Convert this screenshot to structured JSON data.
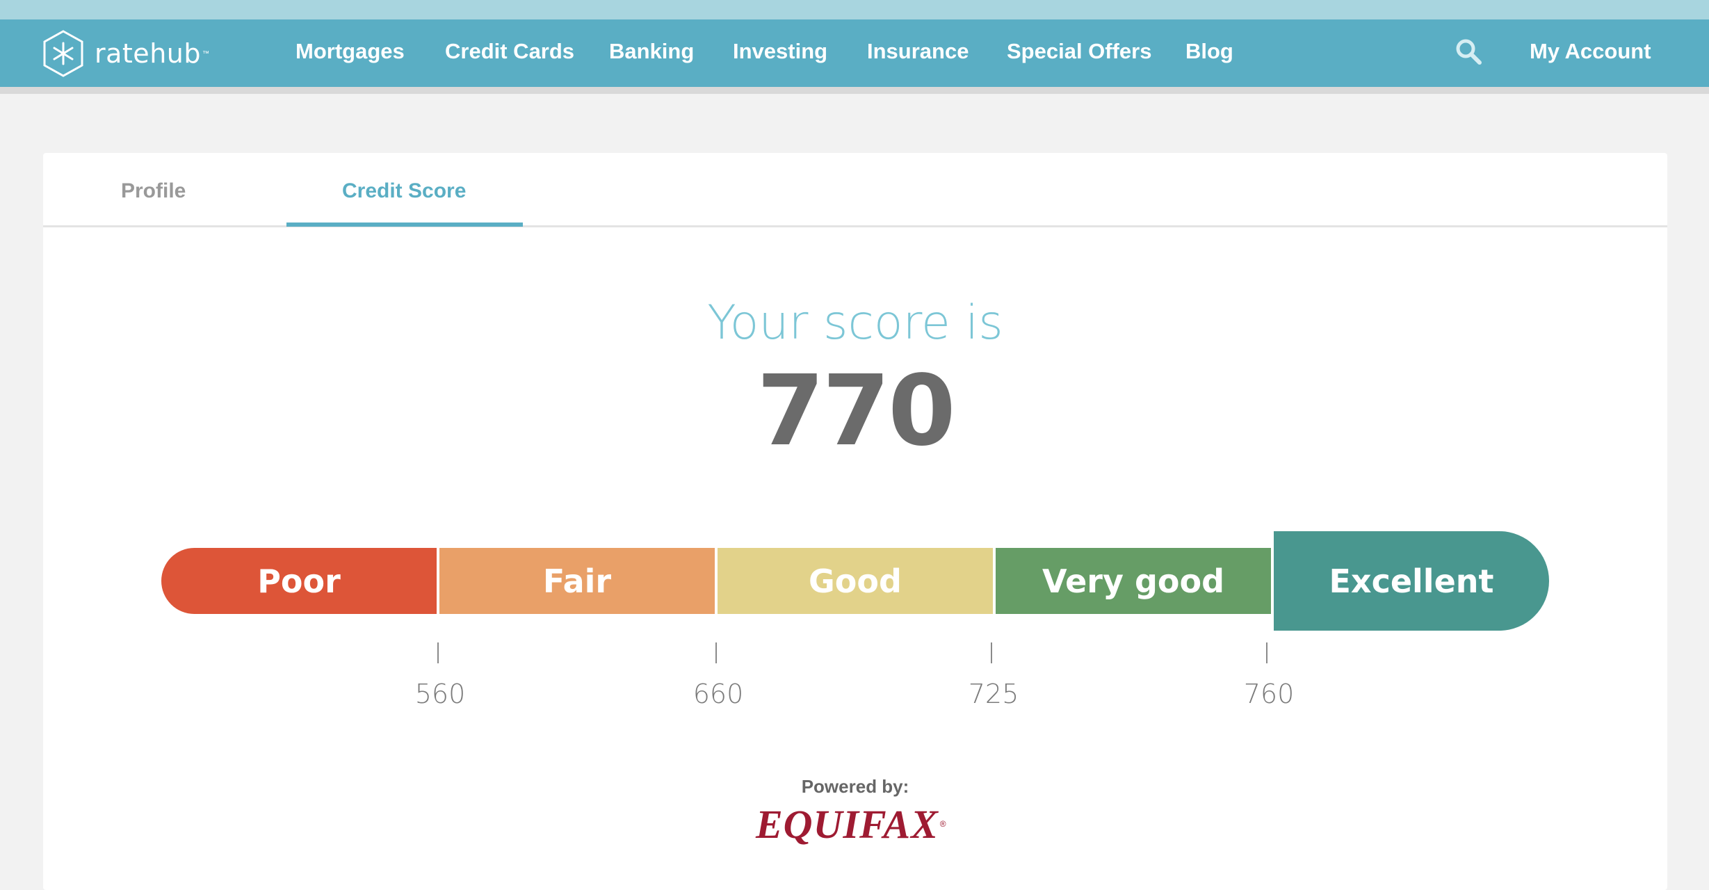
{
  "brand": {
    "logo_text": "ratehub",
    "trademark": "™"
  },
  "nav": {
    "items": [
      {
        "label": "Mortgages"
      },
      {
        "label": "Credit Cards"
      },
      {
        "label": "Banking"
      },
      {
        "label": "Investing"
      },
      {
        "label": "Insurance"
      },
      {
        "label": "Special Offers"
      },
      {
        "label": "Blog"
      }
    ],
    "search_icon": "search-icon",
    "account_label": "My Account"
  },
  "tabs": [
    {
      "label": "Profile",
      "active": false
    },
    {
      "label": "Credit Score",
      "active": true
    }
  ],
  "score": {
    "label": "Your score is",
    "value": "770"
  },
  "scale": {
    "segments": [
      {
        "label": "Poor",
        "color": "#dd5538"
      },
      {
        "label": "Fair",
        "color": "#e9a068"
      },
      {
        "label": "Good",
        "color": "#e2d28a"
      },
      {
        "label": "Very good",
        "color": "#669d66"
      },
      {
        "label": "Excellent",
        "color": "#49978f",
        "highlighted": true
      }
    ],
    "thresholds": [
      "560",
      "660",
      "725",
      "760"
    ]
  },
  "footer": {
    "powered_by": "Powered by:",
    "provider": "EQUIFAX",
    "provider_mark": "®"
  },
  "colors": {
    "brand": "#5aaec4",
    "score_label": "#7cc6d6",
    "score_value": "#6b6b6b",
    "equifax": "#9e1b32"
  }
}
